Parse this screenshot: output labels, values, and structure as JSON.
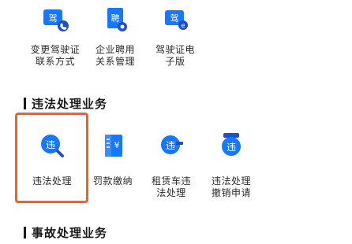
{
  "top_row": [
    {
      "label": "变更驾驶证\n联系方式",
      "icon": "license-phone-icon"
    },
    {
      "label": "企业聘用\n关系管理",
      "icon": "employment-doc-icon"
    },
    {
      "label": "驾驶证电\n子版",
      "icon": "e-license-icon"
    }
  ],
  "violation_section": {
    "title": "违法处理业务",
    "items": [
      {
        "label": "违法处理",
        "icon": "violation-search-icon",
        "glyph": "违"
      },
      {
        "label": "罚款缴纳",
        "icon": "fine-payment-icon"
      },
      {
        "label": "租赁车违\n法处理",
        "icon": "rental-violation-icon",
        "glyph": "违"
      },
      {
        "label": "违法处理\n撤销申请",
        "icon": "violation-revoke-icon",
        "glyph": "违"
      }
    ]
  },
  "accident_section": {
    "title": "事故处理业务"
  },
  "icon_glyphs": {
    "license": "驾",
    "employ": "聘"
  },
  "colors": {
    "primary_blue": "#1677ff",
    "highlight_orange": "#f0621f"
  }
}
